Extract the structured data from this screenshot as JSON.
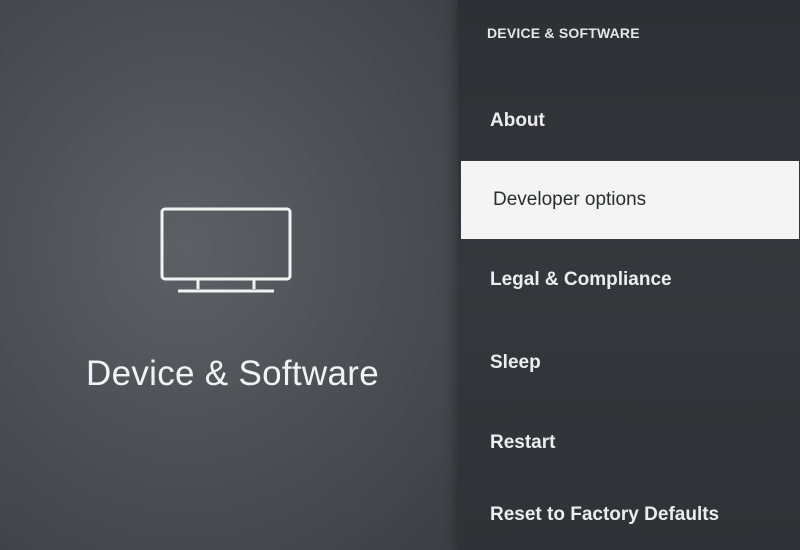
{
  "left_panel": {
    "title": "Device & Software",
    "icon": "tv-icon"
  },
  "right_panel": {
    "header": "DEVICE & SOFTWARE",
    "items": [
      {
        "label": "About",
        "selected": false
      },
      {
        "label": "Developer options",
        "selected": true
      },
      {
        "label": "Legal & Compliance",
        "selected": false
      },
      {
        "label": "Sleep",
        "selected": false
      },
      {
        "label": "Restart",
        "selected": false
      },
      {
        "label": "Reset to Factory Defaults",
        "selected": false
      }
    ]
  },
  "colors": {
    "selected_background": "#f4f4f4",
    "menu_background": "#303337",
    "text": "#ededed"
  }
}
